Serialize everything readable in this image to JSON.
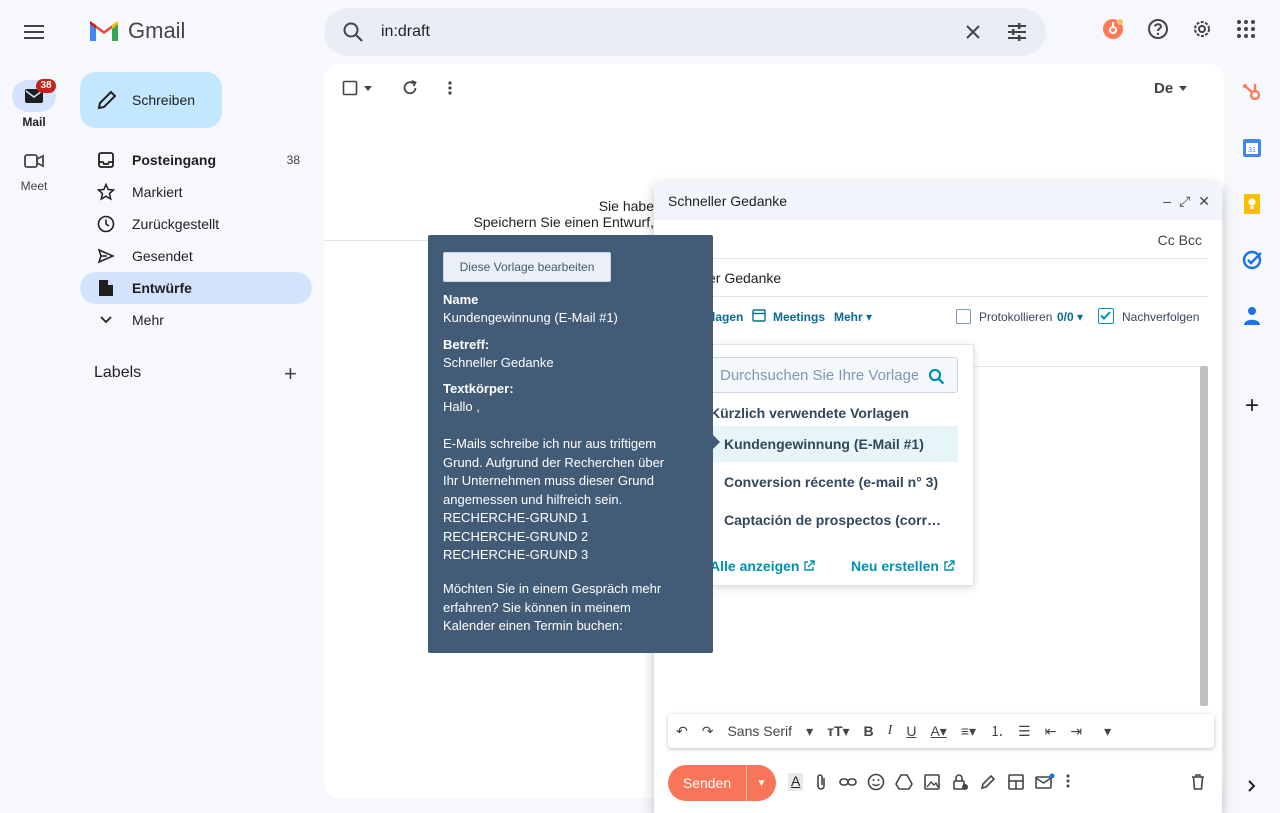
{
  "app": {
    "name": "Gmail"
  },
  "rail": {
    "mail_label": "Mail",
    "mail_badge": "38",
    "meet_label": "Meet"
  },
  "search": {
    "value": "in:draft"
  },
  "compose_button": "Schreiben",
  "nav": [
    {
      "label": "Posteingang",
      "count": "38"
    },
    {
      "label": "Markiert"
    },
    {
      "label": "Zurückgestellt"
    },
    {
      "label": "Gesendet"
    },
    {
      "label": "Entwürfe"
    },
    {
      "label": "Mehr"
    }
  ],
  "labels_heading": "Labels",
  "main": {
    "sort_label": "De",
    "msg_line1": "Sie habe",
    "msg_line2": "Speichern Sie einen Entwurf,"
  },
  "compose_window": {
    "title": "Schneller Gedanke",
    "cc_bcc": "Cc Bcc",
    "subject_partial": "er Gedanke",
    "hubspot": {
      "templates_partial": "lagen",
      "meetings": "Meetings",
      "more": "Mehr",
      "log": "Protokollieren",
      "log_count": "0/0",
      "follow_up": "Nachverfolgen",
      "hidden_line": "...: Kundengewinnung (E-Mail #1)"
    },
    "format": {
      "font": "Sans Serif"
    },
    "send": "Senden"
  },
  "template_dropdown": {
    "search_placeholder": "Durchsuchen Sie Ihre Vorlagen",
    "heading": "Kürzlich verwendete Vorlagen",
    "items": [
      {
        "label": "Kundengewinnung (E-Mail #1)"
      },
      {
        "label": "Conversion récente (e-mail n° 3)"
      },
      {
        "label": "Captación de prospectos (corr…"
      }
    ],
    "show_all": "Alle anzeigen",
    "create_new": "Neu erstellen"
  },
  "tooltip": {
    "edit_button": "Diese Vorlage bearbeiten",
    "name_label": "Name",
    "name_value": "Kundengewinnung (E-Mail #1)",
    "subject_label": "Betreff:",
    "subject_value": "Schneller Gedanke",
    "body_label": "Textkörper:",
    "body_greeting": "Hallo ,",
    "body_p1": "E-Mails schreibe ich nur aus triftigem Grund. Aufgrund der Recherchen über Ihr Unternehmen muss dieser Grund angemessen und hilfreich sein.",
    "reason1": "RECHERCHE-GRUND 1",
    "reason2": "RECHERCHE-GRUND 2",
    "reason3": "RECHERCHE-GRUND 3",
    "body_p2": "Möchten Sie in einem Gespräch mehr erfahren? Sie können in meinem Kalender einen Termin buchen:"
  },
  "colors": {
    "accent": "#c2e7ff",
    "active_nav": "#d3e3fd",
    "hubspot_orange": "#f8755a",
    "tooltip_bg": "#425b76"
  }
}
